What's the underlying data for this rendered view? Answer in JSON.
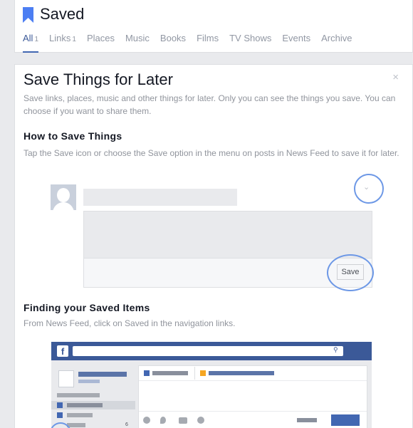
{
  "header": {
    "title": "Saved",
    "tabs": [
      {
        "label": "All",
        "count": "1"
      },
      {
        "label": "Links",
        "count": "1"
      },
      {
        "label": "Places",
        "count": ""
      },
      {
        "label": "Music",
        "count": ""
      },
      {
        "label": "Books",
        "count": ""
      },
      {
        "label": "Films",
        "count": ""
      },
      {
        "label": "TV Shows",
        "count": ""
      },
      {
        "label": "Events",
        "count": ""
      },
      {
        "label": "Archive",
        "count": ""
      }
    ]
  },
  "card": {
    "close": "×",
    "title": "Save Things for Later",
    "intro": "Save links, places, music and other things for later. Only you can see the things you save. You can choose if you want to share them.",
    "section1": {
      "heading": "How to Save Things",
      "text": "Tap the Save icon or choose the Save option in the menu on posts in News Feed to save it for later."
    },
    "example": {
      "chevron": "⌄",
      "save_label": "Save"
    },
    "section2": {
      "heading": "Finding your Saved Items",
      "text": "From News Feed, click on Saved in the navigation links."
    },
    "mini": {
      "logo": "f",
      "search_icon": "⚲",
      "count": "6"
    }
  },
  "colors": {
    "accent": "#3b5998",
    "highlight": "#6d98e6",
    "muted": "#90949c"
  }
}
